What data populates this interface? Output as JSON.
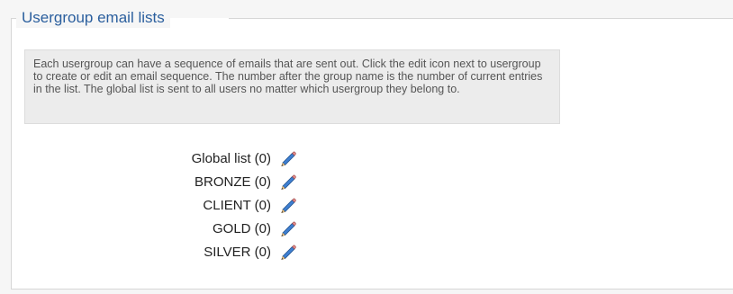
{
  "section": {
    "title": "Usergroup email lists",
    "description": "Each usergroup can have a sequence of emails that are sent out. Click the edit icon next to usergroup to create or edit an email sequence. The number after the group name is the number of current entries in the list. The global list is sent to all users no matter which usergroup they belong to."
  },
  "lists": [
    {
      "label": "Global list (0)",
      "icon": "pencil-edit-icon"
    },
    {
      "label": "BRONZE (0)",
      "icon": "pencil-edit-icon"
    },
    {
      "label": "CLIENT (0)",
      "icon": "pencil-edit-icon"
    },
    {
      "label": "GOLD (0)",
      "icon": "pencil-edit-icon"
    },
    {
      "label": "SILVER (0)",
      "icon": "pencil-edit-icon"
    }
  ],
  "colors": {
    "title": "#2b5f9e",
    "pencil_body": "#3f7fd1",
    "pencil_tip": "#f0c78a"
  }
}
